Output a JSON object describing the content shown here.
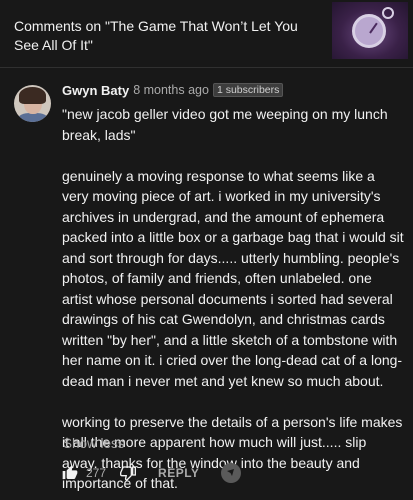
{
  "header": {
    "title": "Comments on \"The Game That Won’t Let You See All Of It\""
  },
  "comment": {
    "author": "Gwyn Baty",
    "time": "8 months ago",
    "badge": "1 subscribers",
    "paragraphs": [
      "\"new jacob geller video got me weeping on my lunch break, lads\"",
      "genuinely a moving response to what seems like a very moving piece of art. i worked in my university's archives in undergrad, and the amount of ephemera packed into a little box or a garbage bag that i would sit and sort through for days..... utterly humbling. people's photos, of family and friends, often unlabeled. one artist whose personal documents i sorted had several drawings of his cat Gwendolyn, and christmas cards written \"by her\", and a little sketch of a tombstone with her name on it. i cried over the long-dead cat of a long-dead man i never met and yet knew so much about.",
      "working to preserve the details of a person's life makes it all the more apparent how much will just..... slip away. thanks for the window into the beauty and importance of that."
    ],
    "show_less": "Show less",
    "like_count": "277",
    "reply_label": "REPLY"
  },
  "icons": {
    "like": "thumbs-up-icon",
    "dislike": "thumbs-down-icon",
    "creator": "creator-avatar-icon"
  }
}
